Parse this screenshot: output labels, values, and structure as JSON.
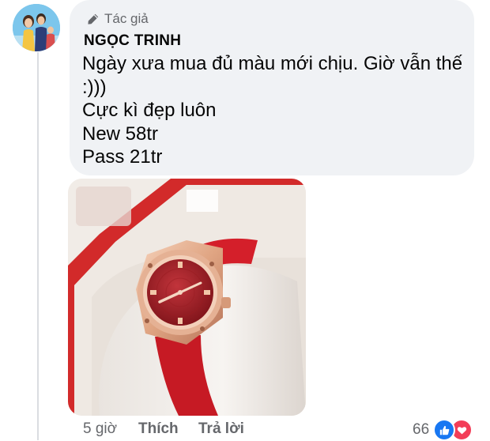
{
  "comment": {
    "author_badge": "Tác giả",
    "author_name": "NGỌC TRINH",
    "text_lines": [
      "Ngày xưa mua đủ màu mới chịu. Giờ vẫn thế",
      ":)))",
      "Cực kì đẹp luôn",
      "New 58tr",
      "Pass 21tr"
    ],
    "attachment": {
      "icon": "watch-photo"
    }
  },
  "actions": {
    "time": "5 giờ",
    "like_label": "Thích",
    "reply_label": "Trả lời"
  },
  "reactions": {
    "count": "66",
    "types": [
      "like-icon",
      "love-icon"
    ]
  },
  "colors": {
    "bubble_bg": "#f0f2f5",
    "meta_text": "#65676b",
    "like_blue": "#1877f2",
    "love_red": "#f33e58",
    "strap_red": "#d41f2a",
    "rose_gold": "#e0a583"
  }
}
